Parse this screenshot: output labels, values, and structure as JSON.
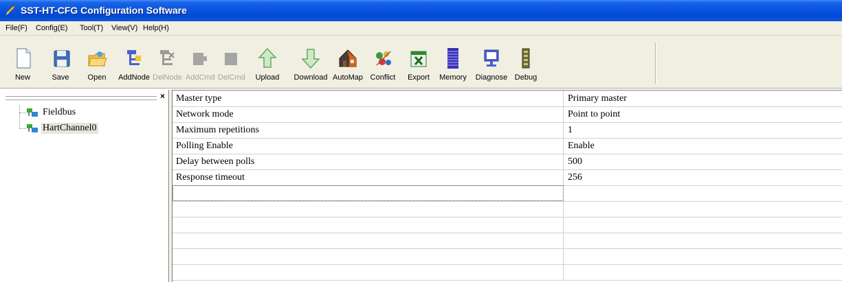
{
  "window": {
    "title": "SST-HT-CFG Configuration Software",
    "icon": "pencil-icon"
  },
  "menu": [
    {
      "label": "File(F)"
    },
    {
      "label": "Config(E)"
    },
    {
      "label": "Tool(T)"
    },
    {
      "label": "View(V)"
    },
    {
      "label": "Help(H)"
    }
  ],
  "toolbar": [
    {
      "label": "New",
      "icon": "new-document-icon",
      "enabled": true
    },
    {
      "label": "Save",
      "icon": "save-disk-icon",
      "enabled": true
    },
    {
      "label": "Open",
      "icon": "open-folder-icon",
      "enabled": true
    },
    {
      "label": "AddNode",
      "icon": "add-node-icon",
      "enabled": true
    },
    {
      "label": "DelNode",
      "icon": "delete-node-icon",
      "enabled": false
    },
    {
      "label": "AddCmd",
      "icon": "add-command-icon",
      "enabled": false
    },
    {
      "label": "DelCmd",
      "icon": "delete-command-icon",
      "enabled": false
    },
    {
      "label": "Upload",
      "icon": "upload-arrow-icon",
      "enabled": true
    },
    {
      "label": "Download",
      "icon": "download-arrow-icon",
      "enabled": true
    },
    {
      "label": "AutoMap",
      "icon": "house-icon",
      "enabled": true
    },
    {
      "label": "Conflict",
      "icon": "conflict-icon",
      "enabled": true
    },
    {
      "label": "Export",
      "icon": "excel-export-icon",
      "enabled": true
    },
    {
      "label": "Memory",
      "icon": "memory-bars-icon",
      "enabled": true
    },
    {
      "label": "Diagnose",
      "icon": "monitor-diagnose-icon",
      "enabled": true
    },
    {
      "label": "Debug",
      "icon": "debug-device-icon",
      "enabled": true
    }
  ],
  "tree": {
    "close_label": "×",
    "nodes": [
      {
        "label": "Fieldbus",
        "icon": "network-node-icon",
        "selected": false
      },
      {
        "label": "HartChannel0",
        "icon": "network-node-icon",
        "selected": true
      }
    ]
  },
  "grid": {
    "rows": [
      {
        "name": "Master type",
        "value": "Primary master"
      },
      {
        "name": "Network mode",
        "value": "Point to point"
      },
      {
        "name": "Maximum repetitions",
        "value": "1"
      },
      {
        "name": "Polling Enable",
        "value": "Enable"
      },
      {
        "name": "Delay between polls",
        "value": "500"
      },
      {
        "name": "Response timeout",
        "value": "256"
      },
      {
        "name": "",
        "value": ""
      },
      {
        "name": "",
        "value": ""
      },
      {
        "name": "",
        "value": ""
      },
      {
        "name": "",
        "value": ""
      },
      {
        "name": "",
        "value": ""
      },
      {
        "name": "",
        "value": ""
      }
    ]
  },
  "colors": {
    "titlebar": "#0a55e0",
    "chrome": "#f1efe2",
    "disabled_text": "#a6a39a"
  }
}
